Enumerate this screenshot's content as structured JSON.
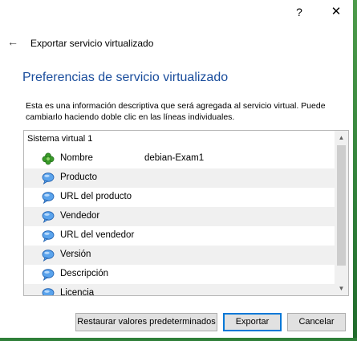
{
  "window": {
    "help": "?",
    "close": "✕"
  },
  "header": {
    "back": "←",
    "title": "Exportar servicio virtualizado"
  },
  "main": {
    "heading": "Preferencias de servicio virtualizado",
    "description": "Esta es una información descriptiva que será agregada al servicio virtual. Puede cambiarlo haciendo doble clic en las líneas individuales."
  },
  "list": {
    "group": "Sistema virtual 1",
    "rows": [
      {
        "label": "Nombre",
        "value": "debian-Exam1",
        "icon": "clover-icon"
      },
      {
        "label": "Producto",
        "value": "",
        "icon": "speech-bubble-icon"
      },
      {
        "label": "URL del producto",
        "value": "",
        "icon": "speech-bubble-icon"
      },
      {
        "label": "Vendedor",
        "value": "",
        "icon": "speech-bubble-icon"
      },
      {
        "label": "URL del vendedor",
        "value": "",
        "icon": "speech-bubble-icon"
      },
      {
        "label": "Versión",
        "value": "",
        "icon": "speech-bubble-icon"
      },
      {
        "label": "Descripción",
        "value": "",
        "icon": "speech-bubble-icon"
      },
      {
        "label": "Licencia",
        "value": "",
        "icon": "speech-bubble-icon"
      }
    ],
    "scroll_up": "▲",
    "scroll_down": "▼"
  },
  "buttons": {
    "restore": "Restaurar valores predeterminados",
    "export": "Exportar",
    "cancel": "Cancelar"
  },
  "colors": {
    "heading": "#1a4d9c",
    "default_button_border": "#0078d7",
    "clover": "#3a9a2a",
    "bubble": "#2f7fd8"
  }
}
